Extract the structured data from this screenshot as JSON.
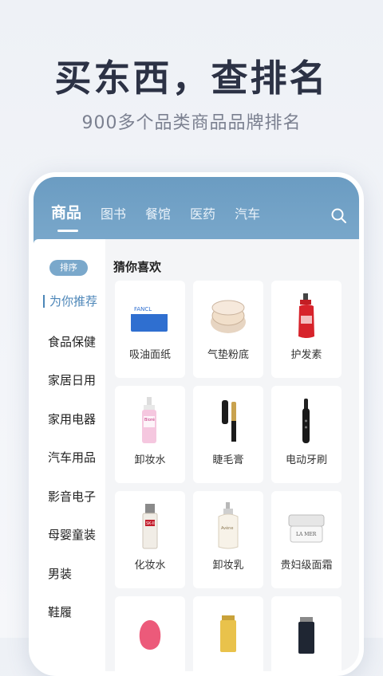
{
  "hero": {
    "title": "买东西，查排名",
    "subtitle": "900多个品类商品品牌排名"
  },
  "tabs": [
    {
      "label": "商品",
      "active": true
    },
    {
      "label": "图书"
    },
    {
      "label": "餐馆"
    },
    {
      "label": "医药"
    },
    {
      "label": "汽车"
    }
  ],
  "sidebar": {
    "sort_label": "排序",
    "items": [
      {
        "label": "为你推荐",
        "active": true
      },
      {
        "label": "食品保健"
      },
      {
        "label": "家居日用"
      },
      {
        "label": "家用电器"
      },
      {
        "label": "汽车用品"
      },
      {
        "label": "影音电子"
      },
      {
        "label": "母婴童装"
      },
      {
        "label": "男装"
      },
      {
        "label": "鞋履"
      }
    ]
  },
  "content": {
    "title": "猜你喜欢",
    "products": [
      {
        "label": "吸油面纸"
      },
      {
        "label": "气垫粉底"
      },
      {
        "label": "护发素"
      },
      {
        "label": "卸妆水"
      },
      {
        "label": "睫毛膏"
      },
      {
        "label": "电动牙刷"
      },
      {
        "label": "化妆水"
      },
      {
        "label": "卸妆乳"
      },
      {
        "label": "贵妇级面霜"
      },
      {
        "label": ""
      },
      {
        "label": ""
      },
      {
        "label": ""
      }
    ],
    "brand_text": {
      "fancl": "FANCL",
      "skii": "SK-II",
      "bioderma": "Bioré",
      "avene": "Avène",
      "lamer": "LA MER"
    }
  },
  "colors": {
    "header": "#7aa8cb",
    "accent": "#4c86b8",
    "title": "#2c3245"
  }
}
